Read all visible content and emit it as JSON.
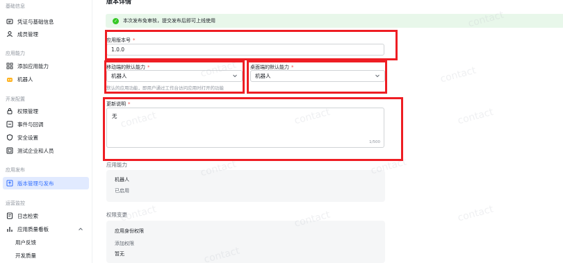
{
  "sidebar": {
    "sections": [
      {
        "title": "基础信息",
        "items": [
          {
            "label": "凭证与基础信息",
            "icon": "id-card-icon"
          },
          {
            "label": "成员管理",
            "icon": "user-icon"
          }
        ]
      },
      {
        "title": "应用能力",
        "items": [
          {
            "label": "添加应用能力",
            "icon": "grid-icon"
          },
          {
            "label": "机器人",
            "icon": "robot-icon"
          }
        ]
      },
      {
        "title": "开发配置",
        "items": [
          {
            "label": "权限管理",
            "icon": "lock-icon"
          },
          {
            "label": "事件与回调",
            "icon": "event-icon"
          },
          {
            "label": "安全设置",
            "icon": "shield-icon"
          },
          {
            "label": "测试企业和人员",
            "icon": "test-icon"
          }
        ]
      },
      {
        "title": "应用发布",
        "items": [
          {
            "label": "版本管理与发布",
            "icon": "version-icon",
            "active": true
          }
        ]
      },
      {
        "title": "运营监控",
        "items": [
          {
            "label": "日志检索",
            "icon": "log-icon"
          },
          {
            "label": "应用质量看板",
            "icon": "chart-icon",
            "expanded": true
          },
          {
            "label": "用户反馈",
            "icon": ""
          },
          {
            "label": "开发质量",
            "icon": ""
          }
        ]
      }
    ]
  },
  "main": {
    "title": "版本详情",
    "banner": "本次发布免审核，提交发布后即可上线使用",
    "version_label": "应用版本号",
    "version_value": "1.0.0",
    "mobile_label": "移动端的默认能力",
    "mobile_value": "机器人",
    "mobile_hint": "默认的应用功能，即用户通过工作台访问应用时打开的功能",
    "desktop_label": "桌面端的默认能力",
    "desktop_value": "机器人",
    "notes_label": "更新说明",
    "notes_value": "无",
    "notes_counter": "1/500",
    "capability_title": "应用能力",
    "capability_lines": [
      "机器人",
      "已启用"
    ],
    "permission_title": "权限变更",
    "permission_lines": [
      "应用身份权限",
      "添加权限",
      "暂无"
    ],
    "required_mark": "*"
  },
  "watermark": "contact",
  "colors": {
    "accent": "#3370ff",
    "highlight": "#ee1d23",
    "success": "#34c724"
  }
}
